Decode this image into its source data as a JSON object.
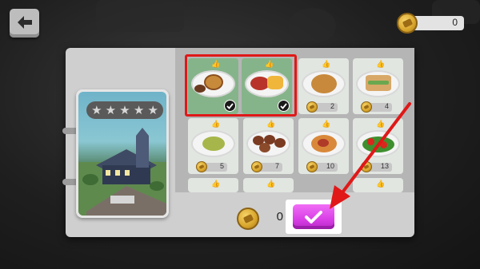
{
  "header": {
    "back_icon": "arrow-left-icon",
    "coins": "0"
  },
  "restaurant_card": {
    "stars": [
      "★",
      "★",
      "★",
      "★",
      "★"
    ]
  },
  "recipes": [
    {
      "dish": "burger plate",
      "selected": true,
      "price": ""
    },
    {
      "dish": "steak and fries plate",
      "selected": true,
      "price": ""
    },
    {
      "dish": "roast chicken plate",
      "selected": false,
      "price": "2"
    },
    {
      "dish": "sandwich plate",
      "selected": false,
      "price": "4"
    },
    {
      "dish": "salad plate",
      "selected": false,
      "price": "5"
    },
    {
      "dish": "meatballs plate",
      "selected": false,
      "price": "7"
    },
    {
      "dish": "pasta plate",
      "selected": false,
      "price": "10"
    },
    {
      "dish": "tomato salad plate",
      "selected": false,
      "price": "13"
    }
  ],
  "footer": {
    "cost": "0",
    "confirm_icon": "checkmark-icon"
  },
  "colors": {
    "confirm": "#d93fe6",
    "highlight": "#e01818",
    "selected_tile": "#86b48a"
  }
}
